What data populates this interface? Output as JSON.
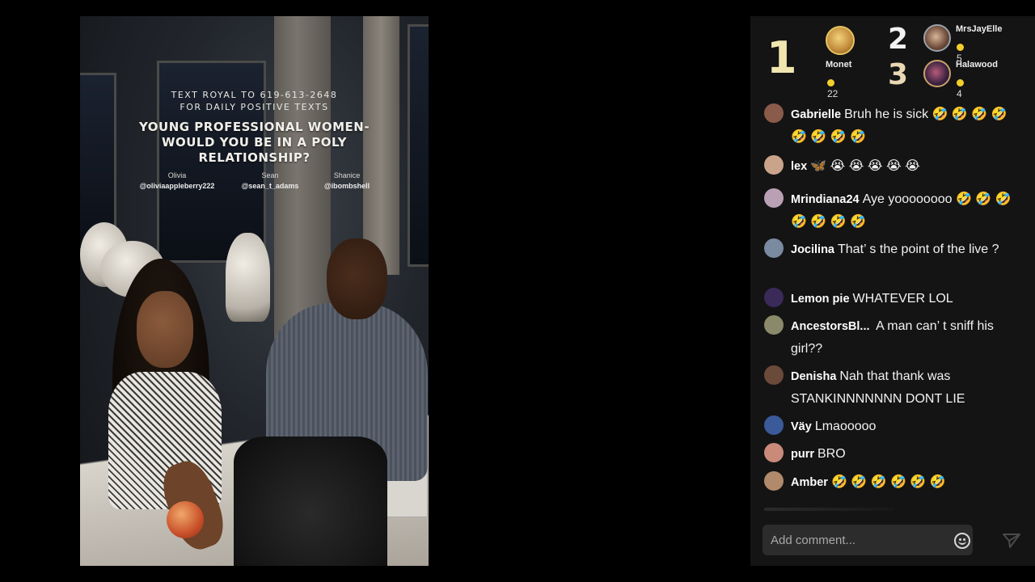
{
  "video": {
    "overlay_line1": "TEXT ROYAL TO 619-613-2648",
    "overlay_line2": "FOR DAILY POSITIVE TEXTS",
    "headline_line1": "YOUNG PROFESSIONAL WOMEN-",
    "headline_line2": "WOULD YOU BE IN A POLY",
    "headline_line3": "RELATIONSHIP?",
    "participants": [
      {
        "name": "Olivia",
        "handle": "@oliviaappleberry222"
      },
      {
        "name": "Sean",
        "handle": "@sean_t_adams"
      },
      {
        "name": "Shanice",
        "handle": "@ibombshell"
      }
    ]
  },
  "leaderboard": [
    {
      "rank": "1",
      "name": "Monet",
      "score": "22"
    },
    {
      "rank": "2",
      "name": "MrsJayElle",
      "score": "5"
    },
    {
      "rank": "3",
      "name": "Halawood",
      "score": "4"
    }
  ],
  "comments": [
    {
      "user": "Gabrielle",
      "text": "Bruh he is sick 🤣 🤣 🤣 🤣 🤣 🤣 🤣 🤣",
      "avatar_color": "#8a5a4a"
    },
    {
      "user": "lex",
      "text": "🦋  😭 😭 😭 😭 😭",
      "avatar_color": "#c9a48a"
    },
    {
      "user": "Mrindiana24",
      "text": "Aye yoooooooo 🤣 🤣 🤣 🤣 🤣 🤣 🤣",
      "avatar_color": "#b9a0b4"
    },
    {
      "user": "Jocilina",
      "text": "That’ s the point of the live ?",
      "avatar_color": "#7a8aa0"
    },
    {
      "user": "Lemon pie",
      "text": "WHATEVER LOL",
      "avatar_color": "#3a2a5a"
    },
    {
      "user": "AncestorsBl...",
      "text": " A man can’ t sniff his girl??",
      "avatar_color": "#8a8a6a"
    },
    {
      "user": "Denisha",
      "text": "Nah that thank was STANKINNNNNNN DONT LIE",
      "avatar_color": "#6a4a3a"
    },
    {
      "user": "Väy",
      "text": "Lmaooooo",
      "avatar_color": "#3a5a9a"
    },
    {
      "user": "purr",
      "text": "BRO",
      "avatar_color": "#c98a7a"
    },
    {
      "user": "Amber",
      "text": "🤣 🤣 🤣 🤣 🤣 🤣",
      "avatar_color": "#b08a6a"
    }
  ],
  "composer": {
    "placeholder": "Add comment..."
  },
  "icons": {
    "emoji": "smiley-icon",
    "send": "send-icon"
  },
  "colors": {
    "panel_bg": "#141414",
    "coin": "#f3cf2c",
    "rank1": "#f2e6b0"
  }
}
